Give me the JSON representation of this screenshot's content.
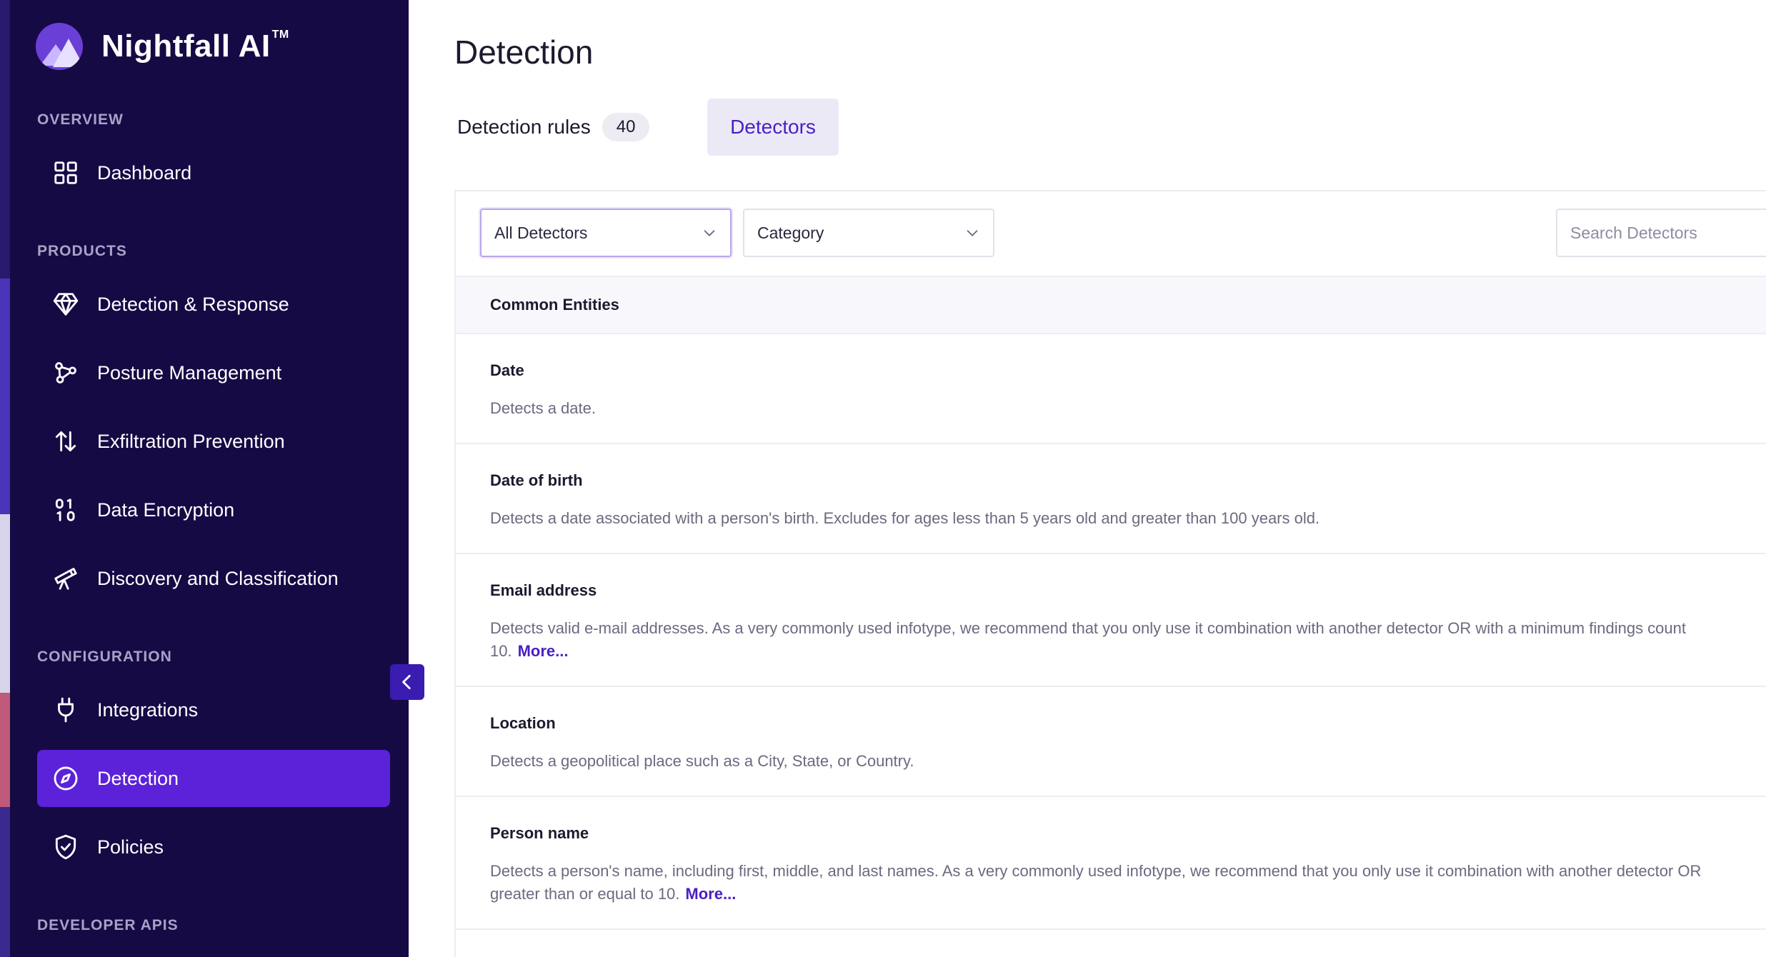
{
  "brand": {
    "name": "Nightfall AI",
    "tm": "TM"
  },
  "sidebar": {
    "sections": {
      "overview": "OVERVIEW",
      "products": "PRODUCTS",
      "configuration": "CONFIGURATION",
      "developer": "DEVELOPER APIS"
    },
    "items": [
      {
        "label": "Dashboard",
        "icon": "grid-icon"
      },
      {
        "label": "Detection & Response",
        "icon": "diamond-icon"
      },
      {
        "label": "Posture Management",
        "icon": "nodes-icon"
      },
      {
        "label": "Exfiltration Prevention",
        "icon": "arrows-updown-icon"
      },
      {
        "label": "Data Encryption",
        "icon": "binary-icon"
      },
      {
        "label": "Discovery and Classification",
        "icon": "telescope-icon"
      },
      {
        "label": "Integrations",
        "icon": "plug-icon"
      },
      {
        "label": "Detection",
        "icon": "compass-icon",
        "active": true
      },
      {
        "label": "Policies",
        "icon": "shield-check-icon"
      }
    ]
  },
  "main": {
    "title": "Detection",
    "tabs": [
      {
        "label": "Detection rules",
        "badge": "40"
      },
      {
        "label": "Detectors",
        "active": true
      }
    ],
    "filters": {
      "detectors_select": "All Detectors",
      "category_select": "Category",
      "search_placeholder": "Search Detectors"
    },
    "group_title": "Common Entities",
    "detectors": [
      {
        "name": "Date",
        "desc": "Detects a date."
      },
      {
        "name": "Date of birth",
        "desc": "Detects a date associated with a person's birth. Excludes for ages less than 5 years old and greater than 100 years old."
      },
      {
        "name": "Email address",
        "desc_line1": "Detects valid e-mail addresses. As a very commonly used infotype, we recommend that you only use it combination with another detector OR with a minimum findings count",
        "desc_line2": "10.",
        "more": "More..."
      },
      {
        "name": "Location",
        "desc": "Detects a geopolitical place such as a City, State, or Country."
      },
      {
        "name": "Person name",
        "desc_line1": "Detects a person's name, including first, middle, and last names. As a very commonly used infotype, we recommend that you only use it combination with another detector OR",
        "desc_line2": "greater than or equal to 10.",
        "more": "More..."
      }
    ]
  },
  "colors": {
    "sidebar_bg": "#160a45",
    "accent": "#5b22d9",
    "link": "#4a1fc4"
  }
}
